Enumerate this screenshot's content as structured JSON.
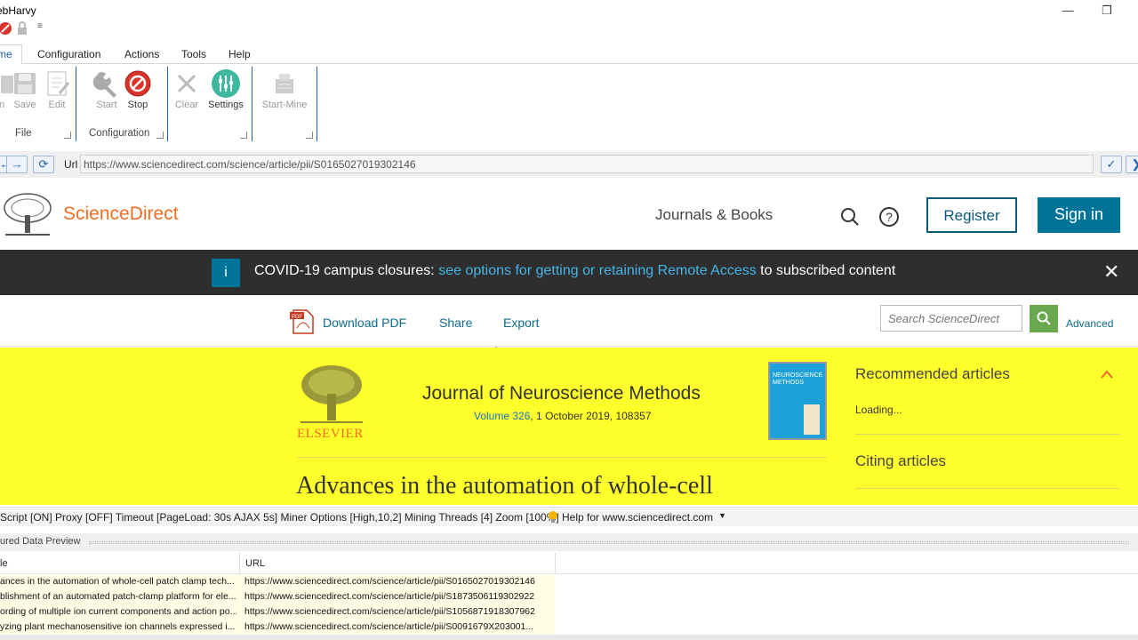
{
  "app": {
    "title": "ebHarvy"
  },
  "ribbon": {
    "tabs": [
      "me",
      "Configuration",
      "Actions",
      "Tools",
      "Help"
    ],
    "buttons": {
      "open": "n",
      "save": "Save",
      "edit": "Edit",
      "start": "Start",
      "stop": "Stop",
      "clear": "Clear",
      "settings": "Settings",
      "start_mine": "Start-Mine"
    },
    "groups": {
      "file": "File",
      "configuration": "Configuration"
    }
  },
  "address": {
    "label": "Url",
    "url": "https://www.sciencedirect.com/science/article/pii/S0165027019302146"
  },
  "site": {
    "brand": "ScienceDirect",
    "journals_books": "Journals & Books",
    "register": "Register",
    "sign_in": "Sign in",
    "banner_info": "i",
    "banner_prefix": "COVID-19 campus closures: ",
    "banner_link": "see options for getting or retaining Remote Access",
    "banner_suffix": " to subscribed content",
    "download_pdf": "Download PDF",
    "share": "Share",
    "export": "Export",
    "search_placeholder": "Search ScienceDirect",
    "advanced": "Advanced",
    "publisher": "ELSEVIER",
    "journal": "Journal of Neuroscience Methods",
    "volume_link": "Volume 326",
    "volume_rest": ", 1 October 2019, 108357",
    "cover_title": "NEUROSCIENCE METHODS",
    "recommended": "Recommended articles",
    "loading": "Loading...",
    "citing": "Citing articles",
    "article_title": "Advances in the automation of whole-cell"
  },
  "status": {
    "text": "Script [ON] Proxy [OFF] Timeout [PageLoad: 30s AJAX 5s] Miner Options [High,10,2] Mining Threads [4] Zoom [100%]",
    "help": "Help for www.sciencedirect.com"
  },
  "preview": {
    "title": "ured Data Preview",
    "columns": [
      "le",
      "URL"
    ],
    "rows": [
      [
        "ances in the automation of whole-cell patch clamp tech...",
        "https://www.sciencedirect.com/science/article/pii/S0165027019302146"
      ],
      [
        "blishment of an automated patch-clamp platform for ele...",
        "https://www.sciencedirect.com/science/article/pii/S1873506119302922"
      ],
      [
        "ording of multiple ion current components and action po...",
        "https://www.sciencedirect.com/science/article/pii/S1056871918307962"
      ],
      [
        "yzing plant mechanosensitive ion channels expressed i...",
        "https://www.sciencedirect.com/science/article/pii/S0091679X203001..."
      ]
    ]
  },
  "colors": {
    "accent": "#1e62b0",
    "brand": "#f36d21",
    "teal": "#007398",
    "highlight": "#ffff2b",
    "search_btn": "#6aa84f"
  }
}
